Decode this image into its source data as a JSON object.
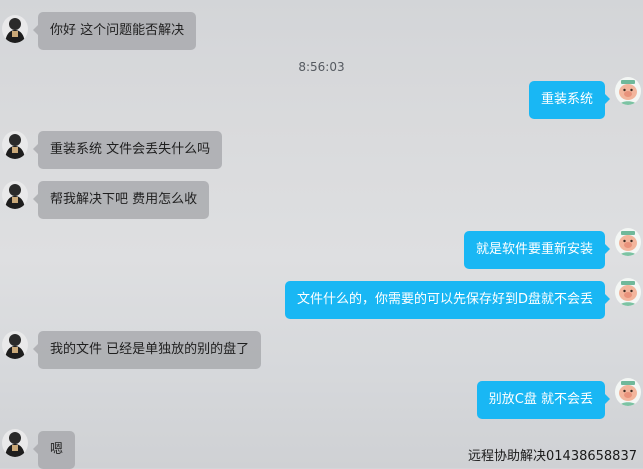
{
  "timestamp": "8:56:03",
  "messages": [
    {
      "side": "left",
      "text": "你好 这个问题能否解决"
    },
    {
      "side": "right",
      "text": "重装系统"
    },
    {
      "side": "left",
      "text": "重装系统 文件会丢失什么吗"
    },
    {
      "side": "left",
      "text": "帮我解决下吧 费用怎么收"
    },
    {
      "side": "right",
      "text": "就是软件要重新安装"
    },
    {
      "side": "right",
      "text": "文件什么的，你需要的可以先保存好到D盘就不会丢"
    },
    {
      "side": "left",
      "text": "我的文件 已经是单独放的别的盘了"
    },
    {
      "side": "right",
      "text": "别放C盘 就不会丢"
    },
    {
      "side": "left",
      "text": "嗯"
    }
  ],
  "footer": "远程协助解决01438658837",
  "colors": {
    "outgoing_bubble": "#19b7f4",
    "incoming_bubble": "#a5a7ab",
    "background": "#d9dadc"
  },
  "icons": {
    "user_avatar": "person-avatar-icon",
    "agent_avatar": "cartoon-pig-avatar-icon"
  }
}
